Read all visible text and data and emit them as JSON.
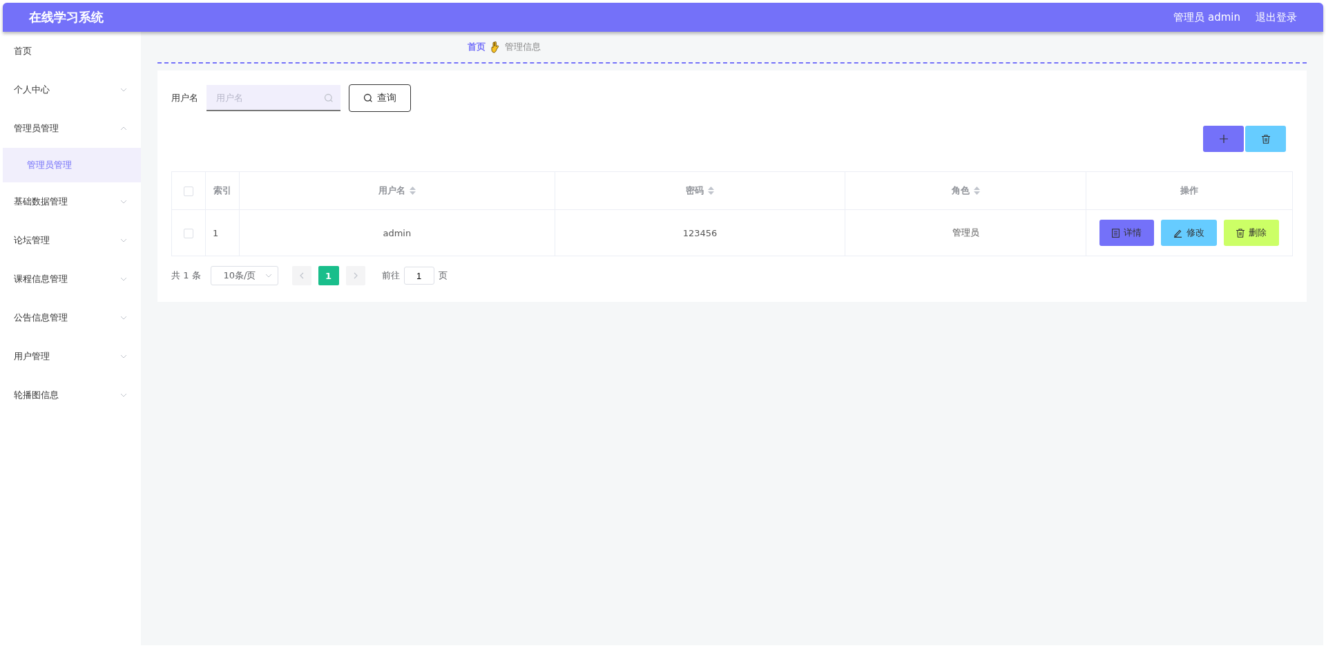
{
  "header": {
    "title": "在线学习系统",
    "user": "管理员 admin",
    "logout": "退出登录"
  },
  "sidebar": {
    "items": [
      {
        "label": "首页",
        "kind": "link",
        "selected": false
      },
      {
        "label": "个人中心",
        "kind": "group",
        "expanded": false,
        "selected": false
      },
      {
        "label": "管理员管理",
        "kind": "group",
        "expanded": true,
        "selected": false,
        "children": [
          {
            "label": "管理员管理",
            "selected": true
          }
        ]
      },
      {
        "label": "基础数据管理",
        "kind": "group",
        "expanded": false,
        "selected": false
      },
      {
        "label": "论坛管理",
        "kind": "group",
        "expanded": false,
        "selected": false
      },
      {
        "label": "课程信息管理",
        "kind": "group",
        "expanded": false,
        "selected": false
      },
      {
        "label": "公告信息管理",
        "kind": "group",
        "expanded": false,
        "selected": false
      },
      {
        "label": "用户管理",
        "kind": "group",
        "expanded": false,
        "selected": false
      },
      {
        "label": "轮播图信息",
        "kind": "group",
        "expanded": false,
        "selected": false
      }
    ]
  },
  "breadcrumb": [
    "首页",
    "管理信息"
  ],
  "search": {
    "label": "用户名",
    "placeholder": "用户名",
    "button": "查询"
  },
  "table": {
    "select_all_checked": false,
    "columns": [
      {
        "label": "索引",
        "sortable": false
      },
      {
        "label": "用户名",
        "sortable": true
      },
      {
        "label": "密码",
        "sortable": true
      },
      {
        "label": "角色",
        "sortable": true
      },
      {
        "label": "操作",
        "sortable": false
      }
    ],
    "rows": [
      {
        "checked": false,
        "cells": [
          "1",
          "admin",
          "123456",
          "管理员"
        ],
        "actions": [
          {
            "label": "详情",
            "kind": "detail"
          },
          {
            "label": "修改",
            "kind": "edit"
          },
          {
            "label": "删除",
            "kind": "delete"
          }
        ]
      }
    ]
  },
  "pagination": {
    "total": "共 1 条",
    "page_size": "10条/页",
    "pages": [
      {
        "label": "1",
        "selected": true
      }
    ],
    "goto_label": "前往",
    "goto_value": "1",
    "goto_suffix": "页"
  }
}
